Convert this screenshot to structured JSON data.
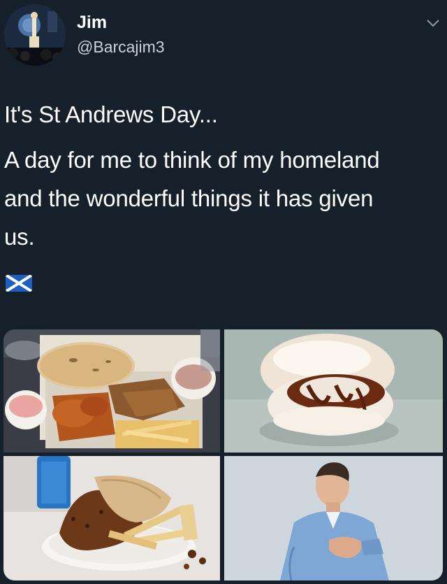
{
  "author": {
    "name": "Jim",
    "handle": "@Barcajim3"
  },
  "tweet": {
    "lines": [
      "It's St Andrews Day...",
      "A day for me to think of my homeland",
      "and the wonderful things it has given",
      "us."
    ],
    "flag_icon": "scotland-flag-icon"
  },
  "media": {
    "images": [
      "kebab-takeaway-photo",
      "burger-with-sauce-photo",
      "haggis-and-chips-photo",
      "man-clutching-chest-photo"
    ]
  },
  "colors": {
    "background": "#15202b",
    "text": "#ffffff",
    "secondary_text": "#c9d3dc"
  }
}
